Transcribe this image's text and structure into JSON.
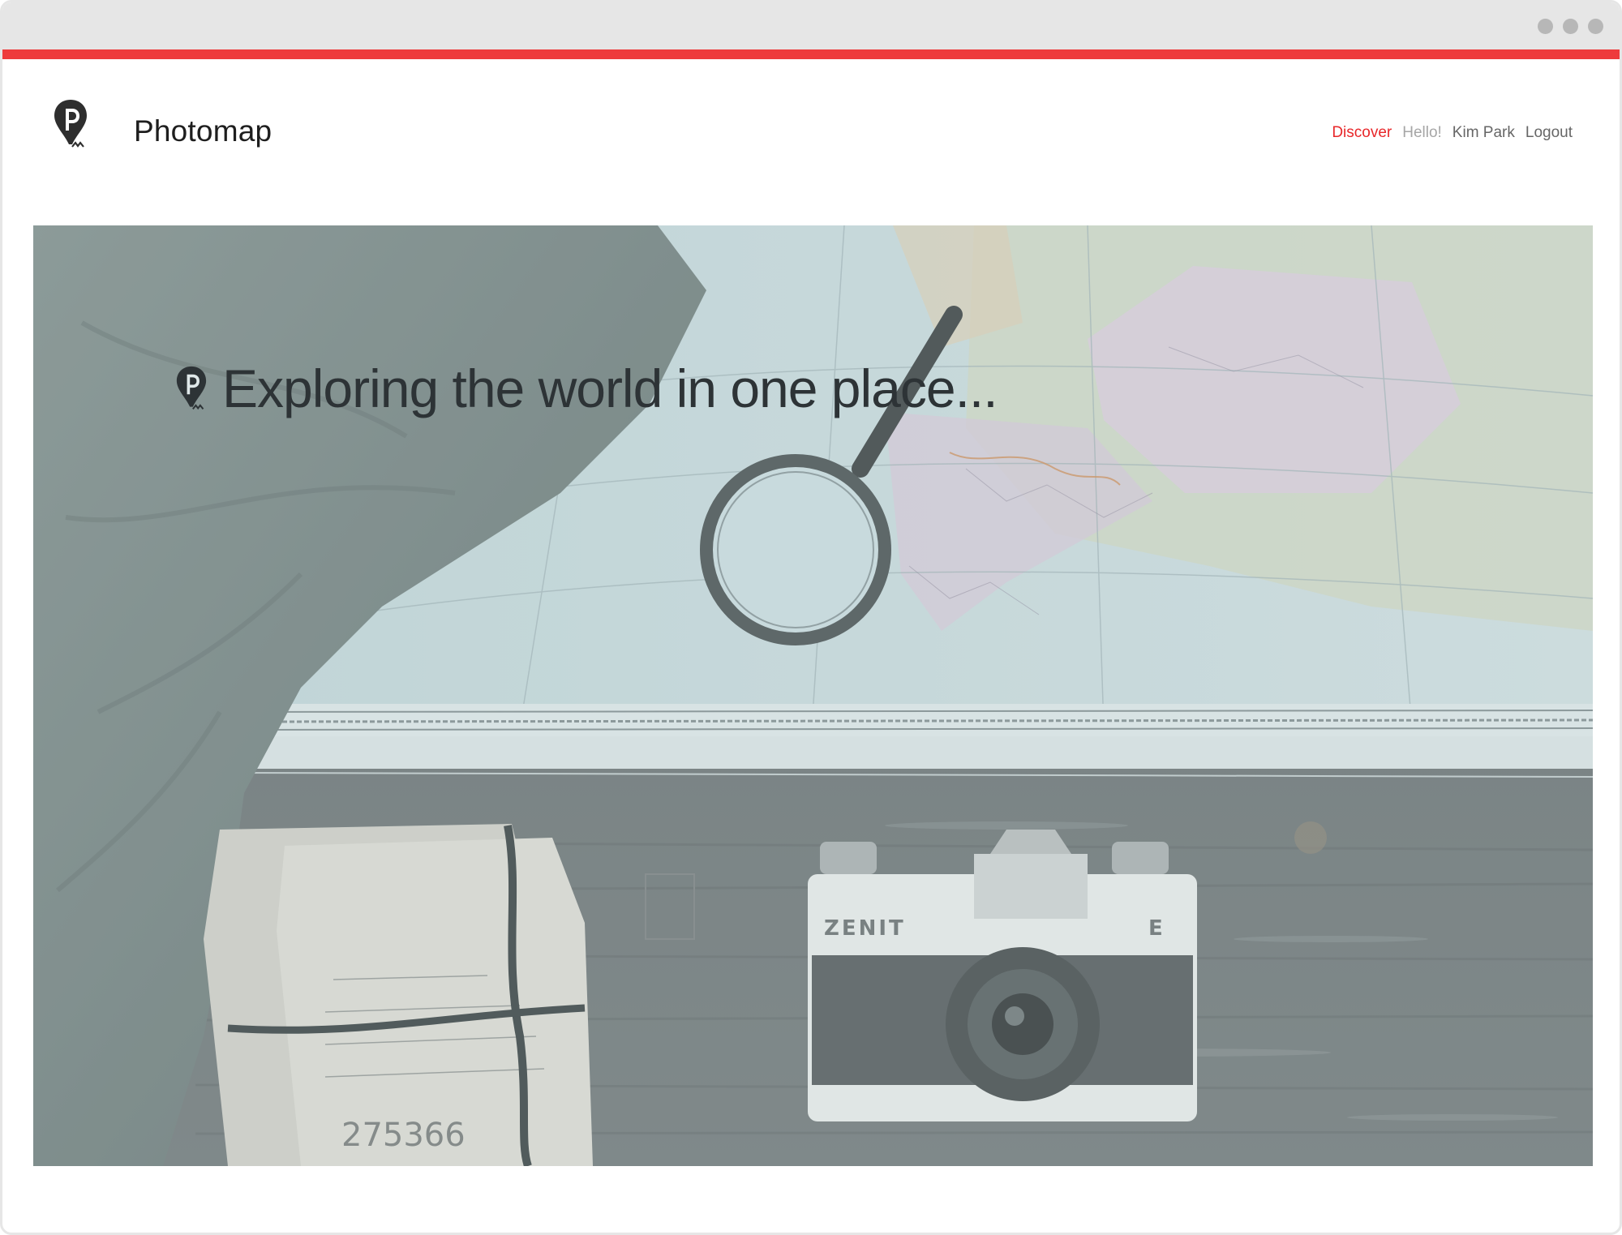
{
  "window": {
    "controls": [
      "dot",
      "dot",
      "dot"
    ]
  },
  "colors": {
    "accent": "#ee3b3c",
    "nav_active": "#e8272a",
    "nav_muted": "#a6a6a6",
    "nav_text": "#666666",
    "brand_text": "#1e1e1e"
  },
  "header": {
    "logo_icon": "map-pin-p-icon",
    "brand": "Photomap",
    "nav": {
      "discover": "Discover",
      "hello": "Hello!",
      "user": "Kim Park",
      "logout": "Logout"
    }
  },
  "hero": {
    "icon": "map-pin-p-icon",
    "tagline": "Exploring the world in one place..."
  }
}
